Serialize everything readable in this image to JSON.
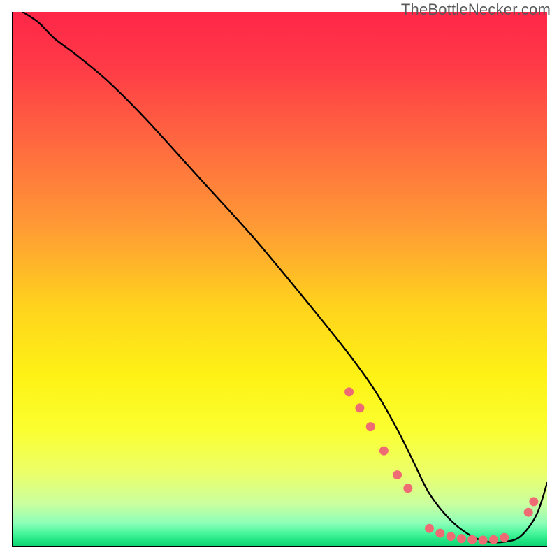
{
  "watermark": "TheBottleNecker.com",
  "chart_data": {
    "type": "line",
    "title": "",
    "xlabel": "",
    "ylabel": "",
    "xlim": [
      0,
      100
    ],
    "ylim": [
      0,
      100
    ],
    "grid": false,
    "legend": false,
    "background_gradient_stops": [
      {
        "offset": 0.0,
        "color": "#ff2648"
      },
      {
        "offset": 0.1,
        "color": "#ff3a47"
      },
      {
        "offset": 0.25,
        "color": "#ff6a3f"
      },
      {
        "offset": 0.4,
        "color": "#ff9a35"
      },
      {
        "offset": 0.55,
        "color": "#ffd31d"
      },
      {
        "offset": 0.68,
        "color": "#fef215"
      },
      {
        "offset": 0.78,
        "color": "#fbff2f"
      },
      {
        "offset": 0.86,
        "color": "#ecff68"
      },
      {
        "offset": 0.92,
        "color": "#caffa0"
      },
      {
        "offset": 0.955,
        "color": "#8dffb8"
      },
      {
        "offset": 0.975,
        "color": "#45f59a"
      },
      {
        "offset": 0.99,
        "color": "#19e07e"
      },
      {
        "offset": 1.0,
        "color": "#0fd072"
      }
    ],
    "series": [
      {
        "name": "bottleneck-curve",
        "color": "#000000",
        "x": [
          2,
          5,
          8,
          12,
          18,
          25,
          35,
          45,
          55,
          63,
          68,
          72,
          75,
          78,
          82,
          86,
          89,
          92,
          95,
          98,
          100
        ],
        "y": [
          100,
          98,
          95,
          92,
          87,
          80,
          69,
          58,
          46,
          36,
          29,
          22,
          16,
          10,
          5,
          2,
          1,
          1,
          2,
          6,
          12
        ]
      }
    ],
    "marker_segments": [
      {
        "name": "descent-segment",
        "color": "#ef6b74",
        "x": [
          63,
          65,
          67,
          69.5,
          72,
          74
        ],
        "y": [
          29,
          26,
          22.5,
          18,
          13.5,
          11
        ]
      },
      {
        "name": "valley-segment",
        "color": "#ef6b74",
        "x": [
          78,
          80,
          82,
          84,
          86,
          88,
          90,
          92
        ],
        "y": [
          3.5,
          2.6,
          2,
          1.6,
          1.4,
          1.3,
          1.4,
          1.8
        ]
      },
      {
        "name": "ascent-segment",
        "color": "#ef6b74",
        "x": [
          96.5,
          97.5
        ],
        "y": [
          6.5,
          8.5
        ]
      }
    ]
  }
}
